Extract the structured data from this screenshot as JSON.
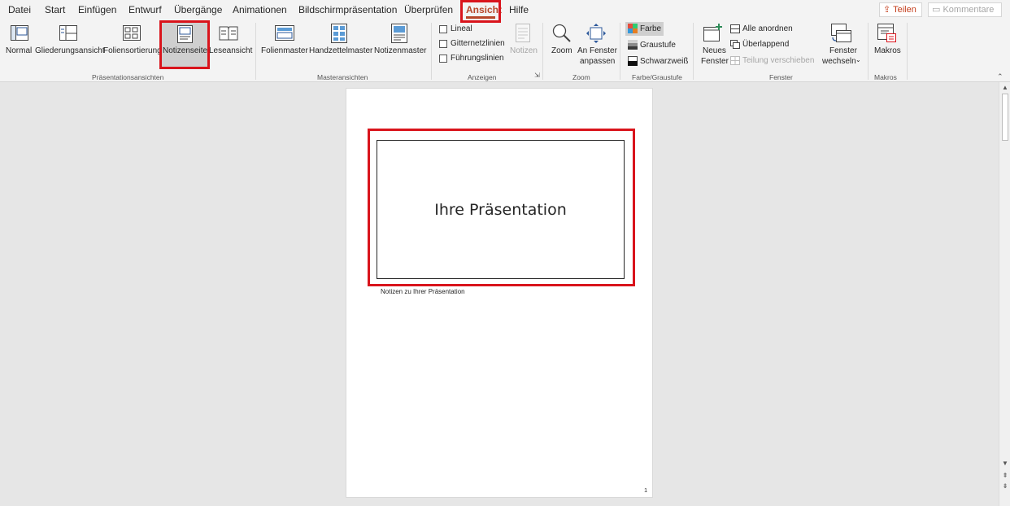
{
  "tabs": {
    "datei": "Datei",
    "start": "Start",
    "einfuegen": "Einfügen",
    "entwurf": "Entwurf",
    "uebergaenge": "Übergänge",
    "animationen": "Animationen",
    "bildschirm": "Bildschirmpräsentation",
    "ueberpruefen": "Überprüfen",
    "ansicht": "Ansicht",
    "hilfe": "Hilfe"
  },
  "share_label": "Teilen",
  "comments_label": "Kommentare",
  "ribbon": {
    "presentation_views": {
      "group_label": "Präsentationsansichten",
      "normal": "Normal",
      "outline": "Gliederungsansicht",
      "sorter": "Foliensortierung",
      "notes_page": "Notizenseite",
      "reading": "Leseansicht"
    },
    "master_views": {
      "group_label": "Masteransichten",
      "slide_master": "Folienmaster",
      "handout_master": "Handzettelmaster",
      "notes_master": "Notizenmaster"
    },
    "show": {
      "group_label": "Anzeigen",
      "ruler": "Lineal",
      "gridlines": "Gitternetzlinien",
      "guides": "Führungslinien",
      "notes": "Notizen"
    },
    "zoom": {
      "group_label": "Zoom",
      "zoom": "Zoom",
      "fit_line1": "An Fenster",
      "fit_line2": "anpassen"
    },
    "color": {
      "group_label": "Farbe/Graustufe",
      "color": "Farbe",
      "grayscale": "Graustufe",
      "bw": "Schwarzweiß"
    },
    "window": {
      "group_label": "Fenster",
      "new_line1": "Neues",
      "new_line2": "Fenster",
      "arrange_all": "Alle anordnen",
      "cascade": "Überlappend",
      "split": "Teilung verschieben",
      "switch_line1": "Fenster",
      "switch_line2": "wechseln"
    },
    "macros": {
      "group_label": "Makros",
      "macros": "Makros"
    }
  },
  "document": {
    "slide_title": "Ihre Präsentation",
    "notes_text": "Notizen zu Ihrer Präsentation",
    "page_number": "1"
  },
  "colors": {
    "accent": "#b7472a",
    "highlight": "#d9141c"
  }
}
